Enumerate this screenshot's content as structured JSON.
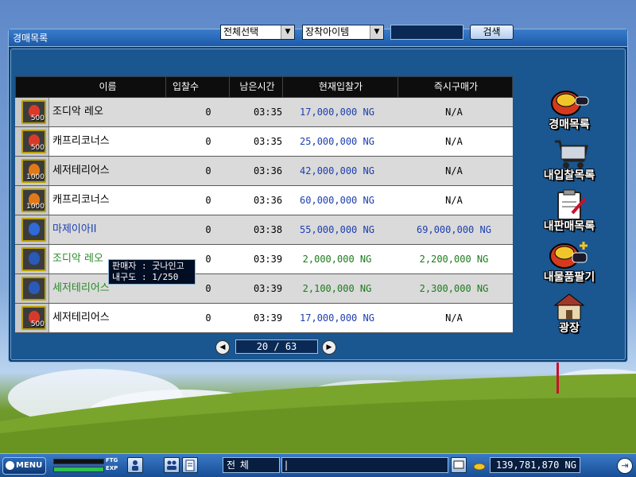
{
  "window": {
    "title": "경매목록"
  },
  "filters": {
    "category_select": "전체선택",
    "type_select": "장착아이템",
    "search_value": "",
    "search_button": "검색"
  },
  "table": {
    "headers": [
      "이름",
      "입찰수",
      "남은시간",
      "현재입찰가",
      "즉시구매가"
    ],
    "rows": [
      {
        "name": "조디악 레오",
        "bids": "0",
        "time": "03:35",
        "current": "17,000,000 NG",
        "buyout": "N/A",
        "qty": "500",
        "icon": "potion-red-icon",
        "name_color": "#000000",
        "price_color": "#1d3fb0",
        "buyout_color": "#000000"
      },
      {
        "name": "캐프리코너스",
        "bids": "0",
        "time": "03:35",
        "current": "25,000,000 NG",
        "buyout": "N/A",
        "qty": "500",
        "icon": "potion-red-icon",
        "name_color": "#000000",
        "price_color": "#1d3fb0",
        "buyout_color": "#000000"
      },
      {
        "name": "세저테리어스",
        "bids": "0",
        "time": "03:36",
        "current": "42,000,000 NG",
        "buyout": "N/A",
        "qty": "1000",
        "icon": "potion-orange-icon",
        "name_color": "#000000",
        "price_color": "#1d3fb0",
        "buyout_color": "#000000"
      },
      {
        "name": "캐프리코너스",
        "bids": "0",
        "time": "03:36",
        "current": "60,000,000 NG",
        "buyout": "N/A",
        "qty": "1000",
        "icon": "potion-orange-icon",
        "name_color": "#000000",
        "price_color": "#1d3fb0",
        "buyout_color": "#000000"
      },
      {
        "name": "마제이아II",
        "bids": "0",
        "time": "03:38",
        "current": "55,000,000 NG",
        "buyout": "69,000,000 NG",
        "qty": "",
        "icon": "blue-card-icon",
        "name_color": "#1d3fb0",
        "price_color": "#1d3fb0",
        "buyout_color": "#1d3fb0"
      },
      {
        "name": "조디악 레오",
        "bids": "0",
        "time": "03:39",
        "current": "2,000,000 NG",
        "buyout": "2,200,000 NG",
        "qty": "",
        "icon": "zodiac-leo-icon",
        "name_color": "#2a8a2a",
        "price_color": "#1e7a1e",
        "buyout_color": "#1e7a1e"
      },
      {
        "name": "세저테리어스",
        "bids": "0",
        "time": "03:39",
        "current": "2,100,000 NG",
        "buyout": "2,300,000 NG",
        "qty": "",
        "icon": "zodiac-sagittarius-icon",
        "name_color": "#2a8a2a",
        "price_color": "#1e7a1e",
        "buyout_color": "#1e7a1e"
      },
      {
        "name": "세저테리어스",
        "bids": "0",
        "time": "03:39",
        "current": "17,000,000 NG",
        "buyout": "N/A",
        "qty": "500",
        "icon": "potion-red-icon",
        "name_color": "#000000",
        "price_color": "#1d3fb0",
        "buyout_color": "#000000"
      }
    ]
  },
  "tooltip": {
    "line1": "판매자 : 굿나인고",
    "line2": "내구도 : 1/250"
  },
  "pagination": {
    "current": "20 / 63"
  },
  "side_menu": [
    {
      "label": "경매목록",
      "icon": "auction-list-icon"
    },
    {
      "label": "내입찰목록",
      "icon": "my-bids-icon"
    },
    {
      "label": "내판매목록",
      "icon": "my-sales-icon"
    },
    {
      "label": "내물품팔기",
      "icon": "sell-item-icon"
    },
    {
      "label": "광장",
      "icon": "plaza-icon"
    }
  ],
  "bottom_bar": {
    "menu_label": "MENU",
    "ftg_label": "FTG",
    "exp_label": "EXP",
    "chat_channel": "전 체",
    "chat_input": "|",
    "money": "139,781,870 NG"
  },
  "colors": {
    "panel_bg": "#1a5690",
    "titlebar": "#2a6cc0",
    "header_bg": "#0d0d0d",
    "price_blue": "#1d3fb0",
    "price_green": "#1e7a1e"
  }
}
